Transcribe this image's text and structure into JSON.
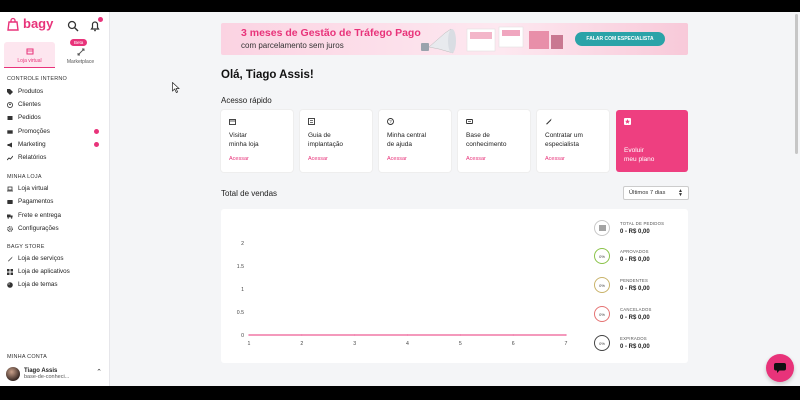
{
  "brand": {
    "name": "bagy"
  },
  "mode_tabs": [
    {
      "label": "Loja virtual",
      "active": true
    },
    {
      "label": "Marketplace",
      "badge": "Beta",
      "active": false
    }
  ],
  "sidebar": {
    "sections": [
      {
        "title": "CONTROLE INTERNO",
        "items": [
          {
            "label": "Produtos",
            "icon": "tag-icon"
          },
          {
            "label": "Clientes",
            "icon": "user-icon"
          },
          {
            "label": "Pedidos",
            "icon": "box-icon"
          },
          {
            "label": "Promoções",
            "icon": "ticket-icon",
            "dot": true
          },
          {
            "label": "Marketing",
            "icon": "megaphone-icon",
            "dot": true
          },
          {
            "label": "Relatórios",
            "icon": "trend-icon"
          }
        ]
      },
      {
        "title": "MINHA LOJA",
        "items": [
          {
            "label": "Loja virtual",
            "icon": "laptop-icon"
          },
          {
            "label": "Pagamentos",
            "icon": "wallet-icon"
          },
          {
            "label": "Frete e entrega",
            "icon": "truck-icon"
          },
          {
            "label": "Configurações",
            "icon": "gear-icon"
          }
        ]
      },
      {
        "title": "BAGY STORE",
        "items": [
          {
            "label": "Loja de serviços",
            "icon": "rocket-icon"
          },
          {
            "label": "Loja de aplicativos",
            "icon": "grid-icon"
          },
          {
            "label": "Loja de temas",
            "icon": "palette-icon"
          }
        ]
      }
    ],
    "account": {
      "title": "MINHA CONTA",
      "name": "Tiago Assis",
      "sub": "base-de-conheci..."
    }
  },
  "banner": {
    "line1": "3 meses de Gestão de Tráfego Pago",
    "line2": "com parcelamento sem juros",
    "cta": "FALAR COM ESPECIALISTA"
  },
  "greeting": "Olá, Tiago Assis!",
  "quick": {
    "title": "Acesso rápido",
    "cards": [
      {
        "label": "Visitar\nminha loja",
        "action": "Acessar",
        "icon": "store-icon"
      },
      {
        "label": "Guia de\nimplantação",
        "action": "Acessar",
        "icon": "checklist-icon"
      },
      {
        "label": "Minha central\nde ajuda",
        "action": "Acessar",
        "icon": "help-icon"
      },
      {
        "label": "Base de\nconhecimento",
        "action": "Acessar",
        "icon": "book-icon"
      },
      {
        "label": "Contratar um\nespecialista",
        "action": "Acessar",
        "icon": "rocket-icon"
      },
      {
        "label": "Evoluir\nmeu plano",
        "action": "",
        "icon": "star-icon",
        "highlight": true
      }
    ]
  },
  "sales": {
    "title": "Total de vendas",
    "period": "Últimos 7 dias",
    "stats": [
      {
        "label": "TOTAL DE PEDIDOS",
        "value": "0 - R$ 0,00",
        "badge": "",
        "color": "#6b6b6b",
        "icon": "list-icon"
      },
      {
        "label": "APROVADOS",
        "value": "0 - R$ 0,00",
        "badge": "0%",
        "color": "#8bc34a"
      },
      {
        "label": "PENDENTES",
        "value": "0 - R$ 0,00",
        "badge": "0%",
        "color": "#c9b36a"
      },
      {
        "label": "CANCELADOS",
        "value": "0 - R$ 0,00",
        "badge": "0%",
        "color": "#e57373"
      },
      {
        "label": "EXPIRADOS",
        "value": "0 - R$ 0,00",
        "badge": "0%",
        "color": "#444444"
      }
    ]
  },
  "chart_data": {
    "type": "line",
    "x": [
      1,
      2,
      3,
      4,
      5,
      6,
      7
    ],
    "series": [
      {
        "values": [
          0,
          0,
          0,
          0,
          0,
          0,
          0
        ]
      }
    ],
    "y_ticks": [
      "0",
      "0.5",
      "1",
      "1.5",
      "2"
    ],
    "ylim": [
      0,
      2
    ],
    "grid": false,
    "line_color": "#e8337a"
  }
}
